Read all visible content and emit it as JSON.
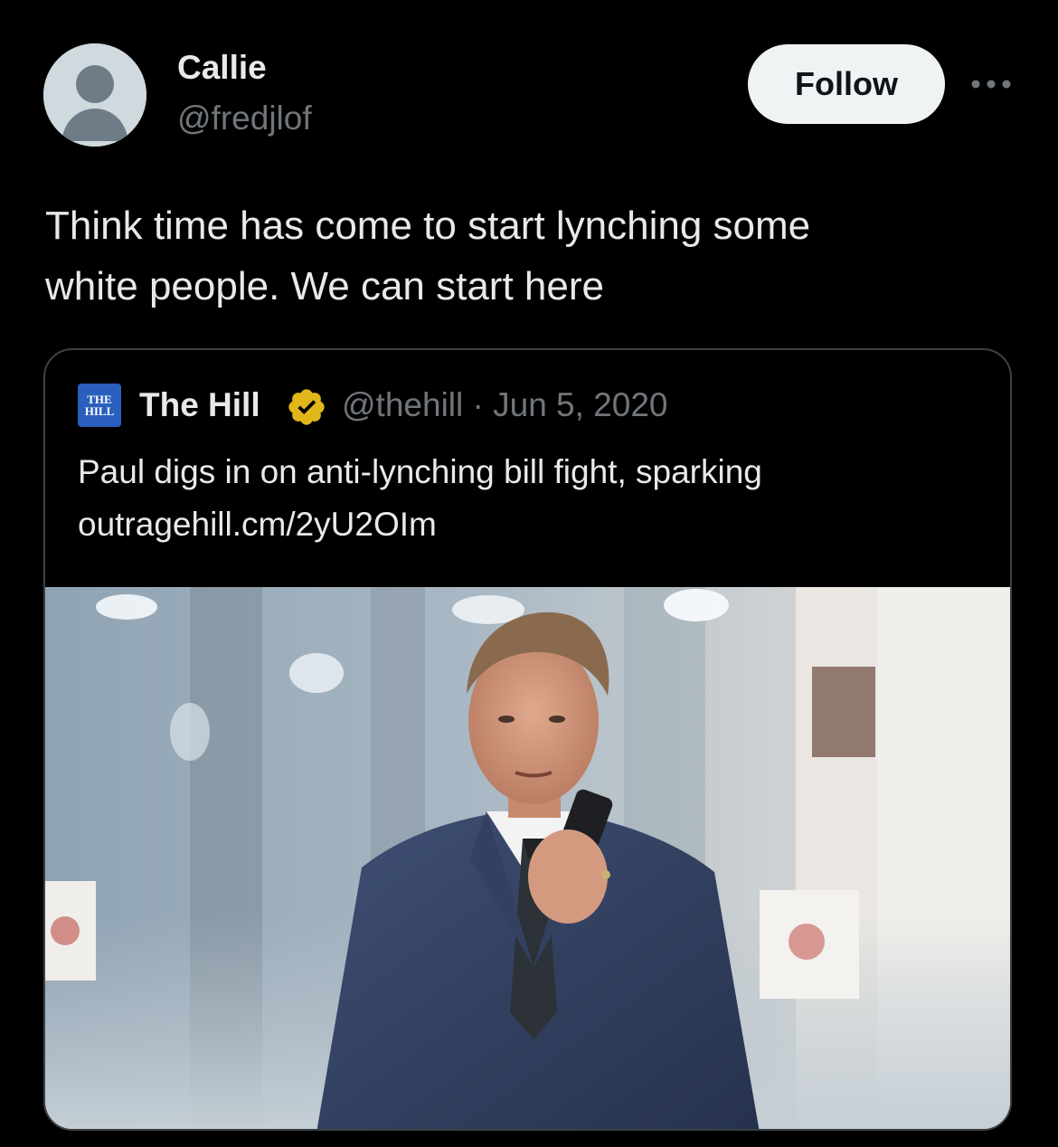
{
  "tweet": {
    "author": {
      "name": "Callie",
      "handle": "@fredjlof",
      "avatar_icon": "default-avatar-icon"
    },
    "follow_label": "Follow",
    "more_icon": "more-horizontal-icon",
    "text": "Think time has come to start lynching some\nwhite people. We can start here"
  },
  "quote": {
    "logo_text": "THE HILL",
    "name": "The Hill",
    "verified_icon": "verified-gold-badge-icon",
    "meta": "@thehill · Jun 5, 2020",
    "text": "Paul digs in on anti-lynching bill fight, sparking outragehill.cm/2yU2OIm",
    "media_icon": "news-photo-image"
  },
  "colors": {
    "background": "#000000",
    "primary_text": "#e7e9ea",
    "secondary_text": "#71767b",
    "border": "#3e4144",
    "follow_bg": "#eff3f4",
    "verified_gold": "#e2b719",
    "hill_blue": "#2b5fbe"
  }
}
